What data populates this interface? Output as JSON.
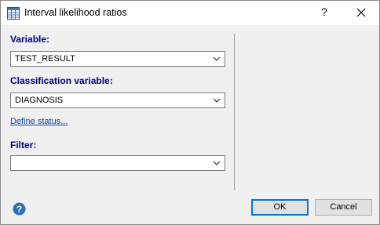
{
  "window": {
    "title": "Interval likelihood ratios",
    "help_glyph": "?",
    "icons": {
      "app": "table-grid-icon",
      "close": "close-icon"
    }
  },
  "form": {
    "variable_label": "Variable:",
    "variable_value": "TEST_RESULT",
    "classification_label": "Classification variable:",
    "classification_value": "DIAGNOSIS",
    "define_status_link": "Define status...",
    "filter_label": "Filter:",
    "filter_value": ""
  },
  "footer": {
    "help_icon": "help-circle-icon",
    "ok_label": "OK",
    "cancel_label": "Cancel"
  },
  "colors": {
    "label_text": "#000080",
    "link_text": "#0645ad",
    "default_button_border": "#0078d7",
    "help_icon_fill": "#2a6ebb"
  }
}
